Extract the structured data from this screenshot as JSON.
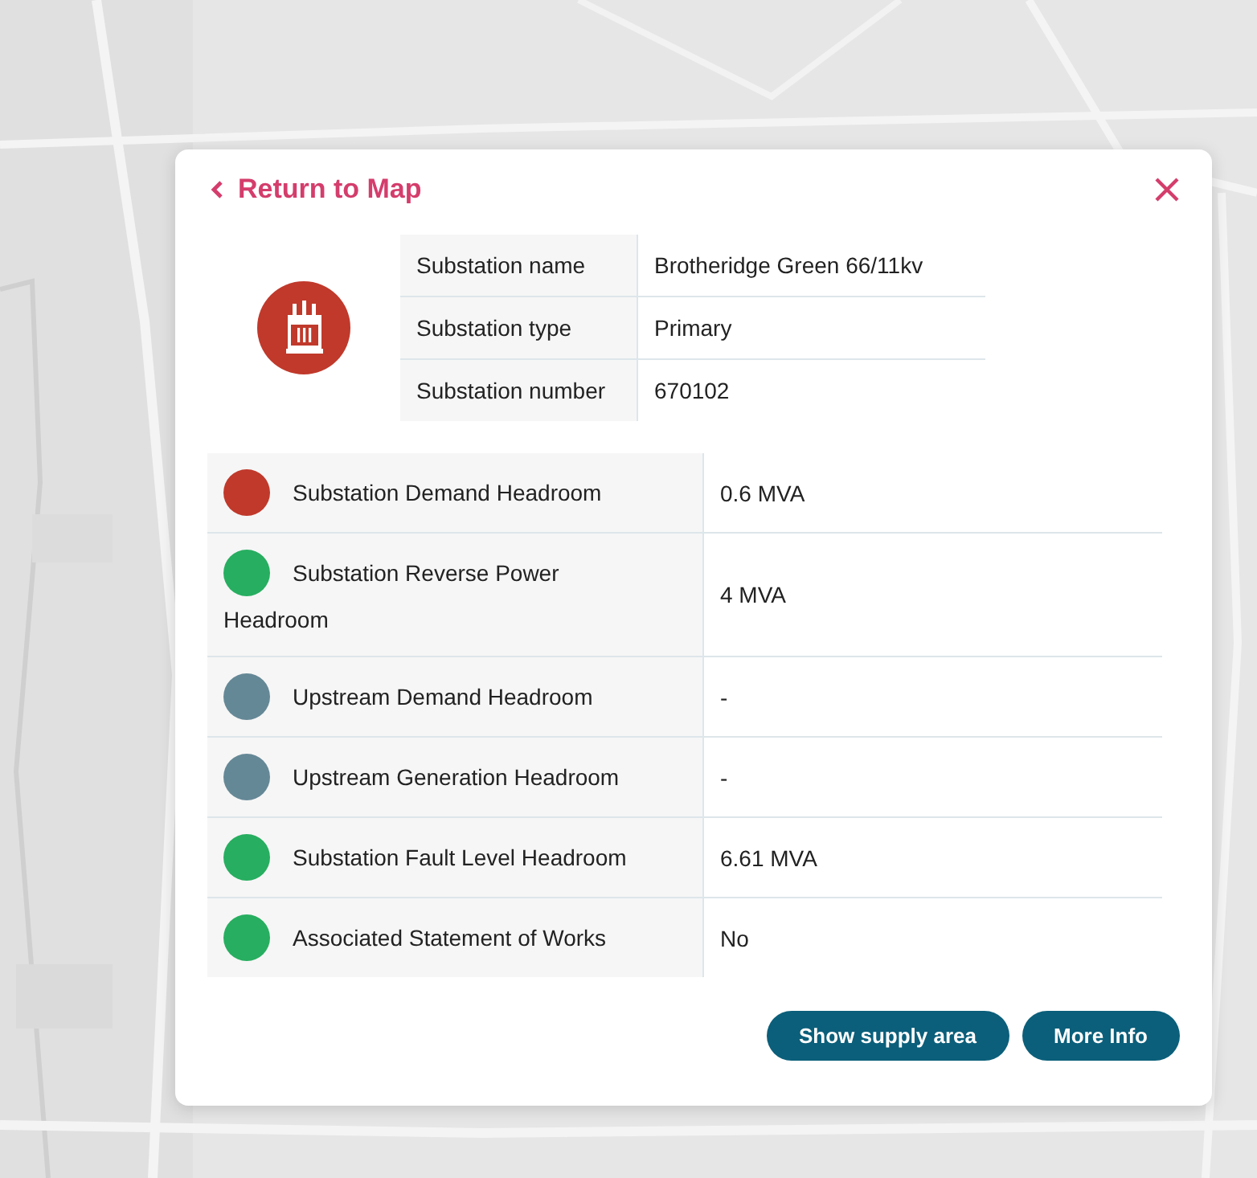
{
  "dialog": {
    "back_link": "Return to Map",
    "details": [
      {
        "label": "Substation name",
        "value": "Brotheridge Green 66/11kv"
      },
      {
        "label": "Substation type",
        "value": "Primary"
      },
      {
        "label": "Substation number",
        "value": "670102"
      }
    ],
    "metrics": [
      {
        "label": "Substation Demand Headroom",
        "value": "0.6 MVA",
        "color": "#c0392b"
      },
      {
        "label": "Substation Reverse Power Headroom",
        "value": "4 MVA",
        "color": "#27ae60"
      },
      {
        "label": "Upstream Demand Headroom",
        "value": "-",
        "color": "#658896"
      },
      {
        "label": "Upstream Generation Headroom",
        "value": "-",
        "color": "#658896"
      },
      {
        "label": "Substation Fault Level Headroom",
        "value": "6.61 MVA",
        "color": "#27ae60"
      },
      {
        "label": "Associated Statement of Works",
        "value": "No",
        "color": "#27ae60"
      }
    ],
    "buttons": [
      "Show supply area",
      "More Info"
    ]
  }
}
